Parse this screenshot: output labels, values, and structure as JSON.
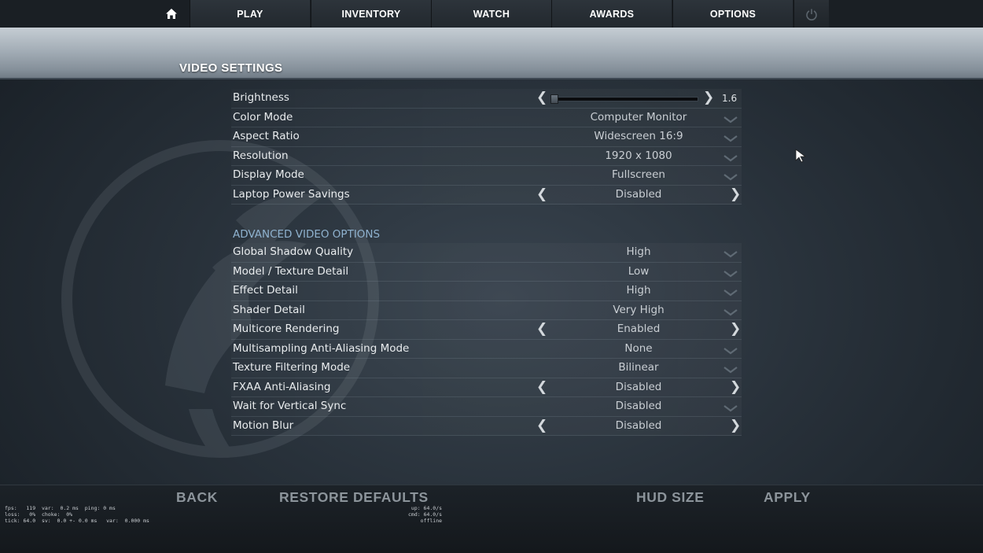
{
  "nav": {
    "home_icon": "home-icon",
    "items": [
      "PLAY",
      "INVENTORY",
      "WATCH",
      "AWARDS",
      "OPTIONS"
    ],
    "power_icon": "power-icon"
  },
  "page": {
    "title": "VIDEO SETTINGS"
  },
  "settings": [
    {
      "label": "Brightness",
      "value": "1.6",
      "control": "slider",
      "level_fraction": 0.0
    },
    {
      "label": "Color Mode",
      "value": "Computer Monitor",
      "control": "dropdown"
    },
    {
      "label": "Aspect Ratio",
      "value": "Widescreen 16:9",
      "control": "dropdown"
    },
    {
      "label": "Resolution",
      "value": "1920 x 1080",
      "control": "dropdown"
    },
    {
      "label": "Display Mode",
      "value": "Fullscreen",
      "control": "dropdown"
    },
    {
      "label": "Laptop Power Savings",
      "value": "Disabled",
      "control": "toggle"
    }
  ],
  "advanced": {
    "title": "ADVANCED VIDEO OPTIONS",
    "items": [
      {
        "label": "Global Shadow Quality",
        "value": "High",
        "control": "dropdown"
      },
      {
        "label": "Model / Texture Detail",
        "value": "Low",
        "control": "dropdown"
      },
      {
        "label": "Effect Detail",
        "value": "High",
        "control": "dropdown"
      },
      {
        "label": "Shader Detail",
        "value": "Very High",
        "control": "dropdown"
      },
      {
        "label": "Multicore Rendering",
        "value": "Enabled",
        "control": "toggle"
      },
      {
        "label": "Multisampling Anti-Aliasing Mode",
        "value": "None",
        "control": "dropdown"
      },
      {
        "label": "Texture Filtering Mode",
        "value": "Bilinear",
        "control": "dropdown"
      },
      {
        "label": "FXAA Anti-Aliasing",
        "value": "Disabled",
        "control": "toggle"
      },
      {
        "label": "Wait for Vertical Sync",
        "value": "Disabled",
        "control": "dropdown"
      },
      {
        "label": "Motion Blur",
        "value": "Disabled",
        "control": "toggle"
      }
    ]
  },
  "bottom": {
    "back": "BACK",
    "restore": "RESTORE DEFAULTS",
    "hud_size": "HUD SIZE",
    "apply": "APPLY"
  },
  "netgraph": {
    "left": "fps:   119  var:  0.2 ms  ping: 0 ms\nloss:   0%  choke:  0%\ntick: 64.0  sv:  0.0 +- 0.0 ms   var:  0.000 ms",
    "right": "up: 64.0/s\ncmd: 64.0/s\noffline"
  },
  "colors": {
    "accent_blue": "#8fb2cf",
    "header_band": "#a3adb6",
    "button_grey": "#8c949b"
  }
}
